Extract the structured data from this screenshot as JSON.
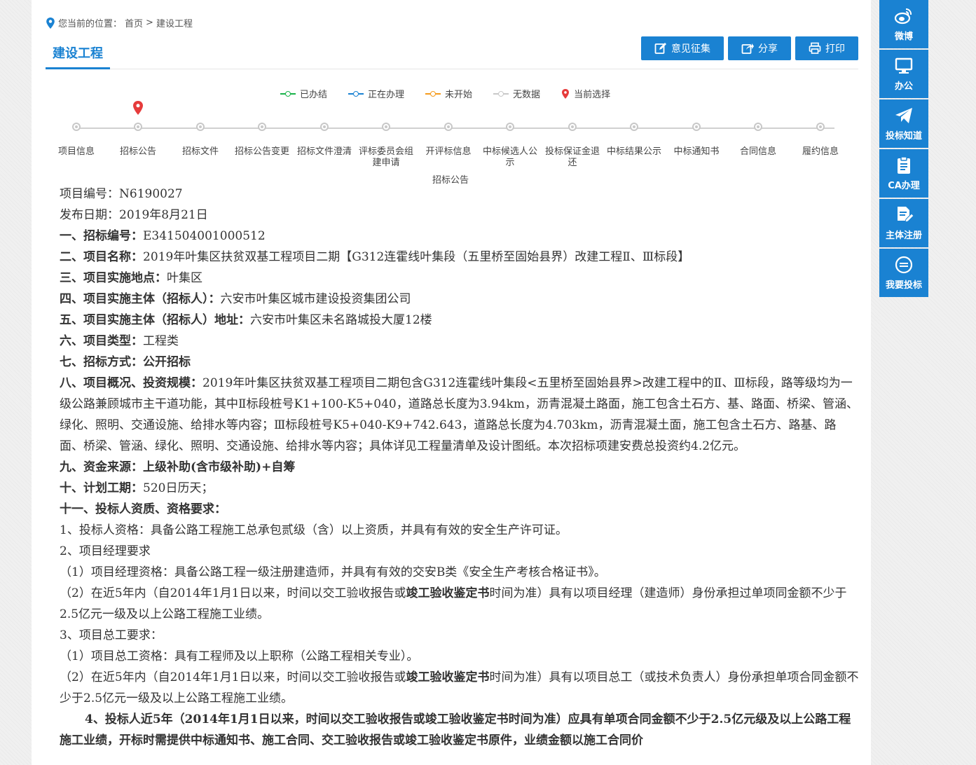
{
  "breadcrumb": {
    "prefix": "您当前的位置：",
    "home": "首页",
    "sep": ">",
    "current": "建设工程"
  },
  "page_title": "建设工程",
  "actions": {
    "opinion": "意见征集",
    "share": "分享",
    "print": "打印"
  },
  "legend": [
    {
      "label": "已办结",
      "color": "#19b34a"
    },
    {
      "label": "正在办理",
      "color": "#1a82d2"
    },
    {
      "label": "未开始",
      "color": "#f59b1c"
    },
    {
      "label": "无数据",
      "color": "#c8c8c8"
    },
    {
      "label": "当前选择",
      "color": "#e63b3b"
    }
  ],
  "steps": [
    "项目信息",
    "招标公告",
    "招标文件",
    "招标公告变更",
    "招标文件澄清",
    "评标委员会组建申请",
    "开评标信息",
    "中标候选人公示",
    "投标保证金退还",
    "中标结果公示",
    "中标通知书",
    "合同信息",
    "履约信息"
  ],
  "current_step": "招标公告",
  "sub_label": "招标公告",
  "article": {
    "p1": "项目编号：N6190027",
    "p2": "发布日期：2019年8月21日",
    "p3_k": "一、招标编号：",
    "p3_v": "E341504001000512",
    "p4_k": "二、项目名称：",
    "p4_v": "2019年叶集区扶贫双基工程项目二期【G312连霍线叶集段（五里桥至固始县界）改建工程Ⅱ、Ⅲ标段】",
    "p5_k": "三、项目实施地点：",
    "p5_v": "叶集区",
    "p6_k": "四、项目实施主体（招标人）：",
    "p6_v": "六安市叶集区城市建设投资集团公司",
    "p7_k": "五、项目实施主体（招标人）地址：",
    "p7_v": "六安市叶集区未名路城投大厦12楼",
    "p8_k": "六、项目类型：",
    "p8_v": "工程类",
    "p9": "七、招标方式：公开招标",
    "p10_k": "八、项目概况、投资规模：",
    "p10_v": "2019年叶集区扶贫双基工程项目二期包含G312连霍线叶集段<五里桥至固始县界>改建工程中的Ⅱ、Ⅲ标段，路等级均为一级公路兼顾城市主干道功能，其中Ⅱ标段桩号K1+100-K5+040，道路总长度为3.94km，沥青混凝土路面，施工包含土石方、基、路面、桥梁、管涵、绿化、照明、交通设施、给排水等内容；Ⅲ标段桩号K5+040-K9+742.643，道路总长度为4.703km，沥青混凝土面，施工包含土石方、路基、路面、桥梁、管涵、绿化、照明、交通设施、给排水等内容；具体详见工程量清单及设计图纸。本次招标项建安费总投资约4.2亿元。",
    "p11": "九、资金来源：上级补助(含市级补助)+自筹",
    "p12_k": "十、计划工期：",
    "p12_v": "520日历天；",
    "p13": "十一、投标人资质、资格要求：",
    "p14": "1、投标人资格：具备公路工程施工总承包贰级（含）以上资质，并具有有效的安全生产许可证。",
    "p15": "2、项目经理要求",
    "p16": "（1）项目经理资格：具备公路工程一级注册建造师，并具有有效的交安B类《安全生产考核合格证书》。",
    "p17_a": "（2）在近5年内（自2014年1月1日以来，时间以交工验收报告或",
    "p17_b": "竣工验收鉴定书",
    "p17_c": "时间为准）具有以项目经理（建造师）身份承担过单项同金额不少于2.5亿元一级及以上公路工程施工业绩。",
    "p18": "3、项目总工要求：",
    "p19": "（1）项目总工资格：具有工程师及以上职称（公路工程相关专业）。",
    "p20_a": "（2）在近5年内（自2014年1月1日以来，时间以交工验收报告或",
    "p20_b": "竣工验收鉴定书",
    "p20_c": "时间为准）具有以项目总工（或技术负责人）身份承担单项合同金额不少于2.5亿元一级及以上公路工程施工业绩。",
    "p21": "4、投标人近5年（2014年1月1日以来，时间以交工验收报告或竣工验收鉴定书时间为准）应具有单项合同金额不少于2.5亿元级及以上公路工程施工业绩，开标时需提供中标通知书、施工合同、交工验收报告或竣工验收鉴定书原件，业绩金额以施工合同价"
  },
  "sidebar": [
    {
      "label": "微博",
      "icon": "weibo-icon"
    },
    {
      "label": "办公",
      "icon": "monitor-icon"
    },
    {
      "label": "投标知道",
      "icon": "paper-plane-icon"
    },
    {
      "label": "CA办理",
      "icon": "clipboard-icon"
    },
    {
      "label": "主体注册",
      "icon": "edit-document-icon"
    },
    {
      "label": "我要投标",
      "icon": "bid-circle-icon"
    }
  ]
}
